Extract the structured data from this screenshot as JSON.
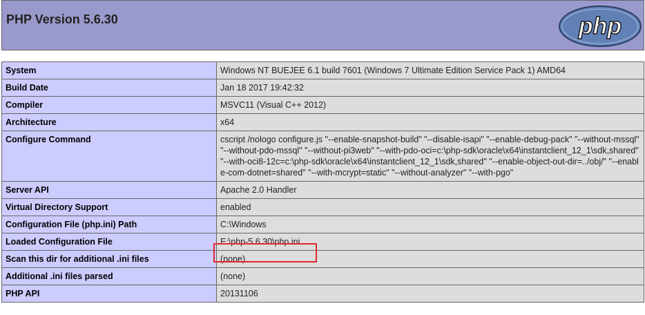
{
  "header": {
    "title": "PHP Version 5.6.30",
    "logo_text": "php",
    "logo_color": "#6181b6"
  },
  "rows": [
    {
      "key": "System",
      "value": "Windows NT BUEJEE 6.1 build 7601 (Windows 7 Ultimate Edition Service Pack 1) AMD64"
    },
    {
      "key": "Build Date",
      "value": "Jan 18 2017 19:42:32"
    },
    {
      "key": "Compiler",
      "value": "MSVC11 (Visual C++ 2012)"
    },
    {
      "key": "Architecture",
      "value": "x64"
    },
    {
      "key": "Configure Command",
      "value": "cscript /nologo configure.js \"--enable-snapshot-build\" \"--disable-isapi\" \"--enable-debug-pack\" \"--without-mssql\" \"--without-pdo-mssql\" \"--without-pi3web\" \"--with-pdo-oci=c:\\php-sdk\\oracle\\x64\\instantclient_12_1\\sdk,shared\" \"--with-oci8-12c=c:\\php-sdk\\oracle\\x64\\instantclient_12_1\\sdk,shared\" \"--enable-object-out-dir=../obj/\" \"--enable-com-dotnet=shared\" \"--with-mcrypt=static\" \"--without-analyzer\" \"--with-pgo\""
    },
    {
      "key": "Server API",
      "value": "Apache 2.0 Handler"
    },
    {
      "key": "Virtual Directory Support",
      "value": "enabled"
    },
    {
      "key": "Configuration File (php.ini) Path",
      "value": "C:\\Windows"
    },
    {
      "key": "Loaded Configuration File",
      "value": "E:\\php-5.6.30\\php.ini"
    },
    {
      "key": "Scan this dir for additional .ini files",
      "value": "(none)"
    },
    {
      "key": "Additional .ini files parsed",
      "value": "(none)"
    },
    {
      "key": "PHP API",
      "value": "20131106"
    }
  ],
  "highlight_color": "#e0282e"
}
